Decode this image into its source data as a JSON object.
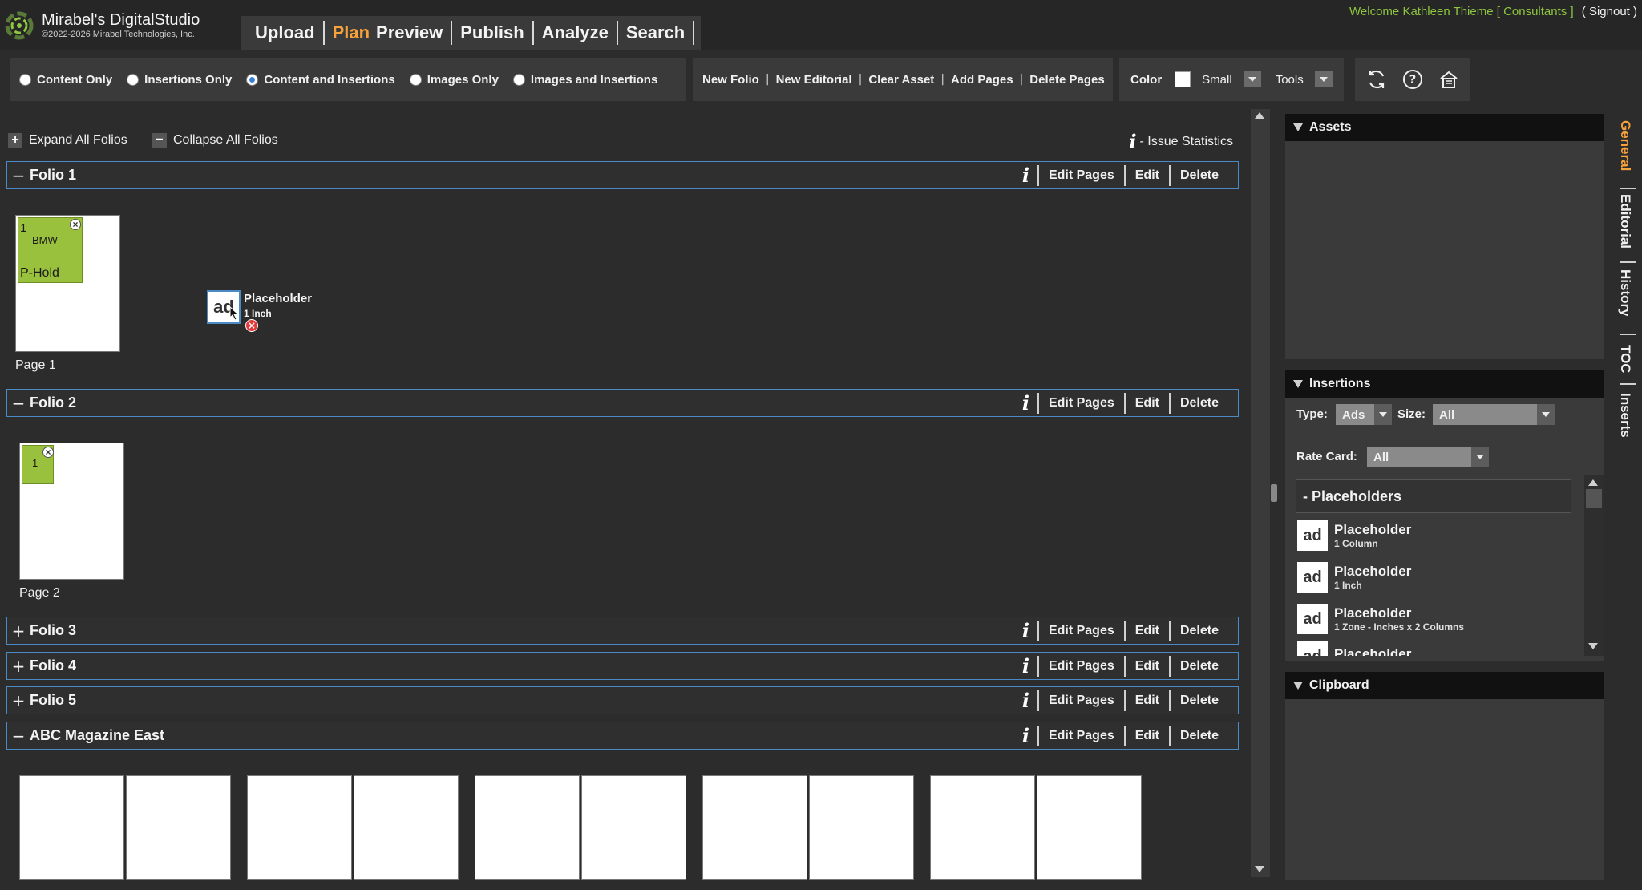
{
  "header": {
    "logo_title": "Mirabel's DigitalStudio",
    "logo_copyright": "©2022-2026 Mirabel Technologies, Inc.",
    "nav": [
      {
        "label": "Upload",
        "active": false
      },
      {
        "label": "Plan",
        "active": true
      },
      {
        "label": "Preview",
        "active": false
      },
      {
        "label": "Publish",
        "active": false
      },
      {
        "label": "Analyze",
        "active": false
      },
      {
        "label": "Search",
        "active": false
      }
    ],
    "welcome": "Welcome Kathleen Thieme [ Consultants ]",
    "signout": "( Signout )",
    "accent_color": "#f7a23b",
    "welcome_color": "#8dc63f"
  },
  "view_options": {
    "selected": "Content and Insertions",
    "options": [
      "Content Only",
      "Insertions Only",
      "Content and Insertions",
      "Images Only",
      "Images and Insertions"
    ]
  },
  "actions": [
    "New Folio",
    "New Editorial",
    "Clear Asset",
    "Add Pages",
    "Delete Pages"
  ],
  "display": {
    "color_label": "Color",
    "size_value": "Small",
    "tools_label": "Tools"
  },
  "tool_icons": [
    "refresh-icon",
    "help-icon",
    "home-icon"
  ],
  "folio_controls": {
    "expand_all": "Expand All Folios",
    "collapse_all": "Collapse All Folios",
    "issue_stats": "- Issue Statistics",
    "info_glyph": "i"
  },
  "folio_actions": [
    "Edit Pages",
    "Edit",
    "Delete"
  ],
  "folios": [
    {
      "name": "Folio 1",
      "expanded": true
    },
    {
      "name": "Folio 2",
      "expanded": true
    },
    {
      "name": "Folio 3",
      "expanded": false
    },
    {
      "name": "Folio 4",
      "expanded": false
    },
    {
      "name": "Folio 5",
      "expanded": false
    },
    {
      "name": "ABC Magazine East",
      "expanded": true
    }
  ],
  "toggle_glyphs": {
    "expanded": "−",
    "collapsed": "+"
  },
  "pages": {
    "page1": {
      "label": "Page 1",
      "ad_number": "1",
      "ad_name": "BMW",
      "ad_status": "P-Hold"
    },
    "page2": {
      "label": "Page 2",
      "ad_number": "1"
    }
  },
  "dragging_placeholder": {
    "icon_text": "ad",
    "title": "Placeholder",
    "size": "1 Inch"
  },
  "right_panel": {
    "assets_title": "Assets",
    "insertions_title": "Insertions",
    "type_label": "Type:",
    "type_value": "Ads",
    "size_label": "Size:",
    "size_value": "All",
    "rate_card_label": "Rate Card:",
    "rate_card_value": "All",
    "placeholders_header": "- Placeholders",
    "placeholder_items": [
      {
        "icon_text": "ad",
        "title": "Placeholder",
        "sub": "1 Column"
      },
      {
        "icon_text": "ad",
        "title": "Placeholder",
        "sub": "1 Inch"
      },
      {
        "icon_text": "ad",
        "title": "Placeholder",
        "sub": "1 Zone - Inches x 2 Columns"
      },
      {
        "icon_text": "ad",
        "title": "Placeholder",
        "sub": ""
      }
    ],
    "clipboard_title": "Clipboard"
  },
  "vertical_tabs": [
    {
      "label": "General",
      "active": true
    },
    {
      "label": "Editorial",
      "active": false
    },
    {
      "label": "History",
      "active": false
    },
    {
      "label": "TOC",
      "active": false
    },
    {
      "label": "Inserts",
      "active": false
    }
  ]
}
